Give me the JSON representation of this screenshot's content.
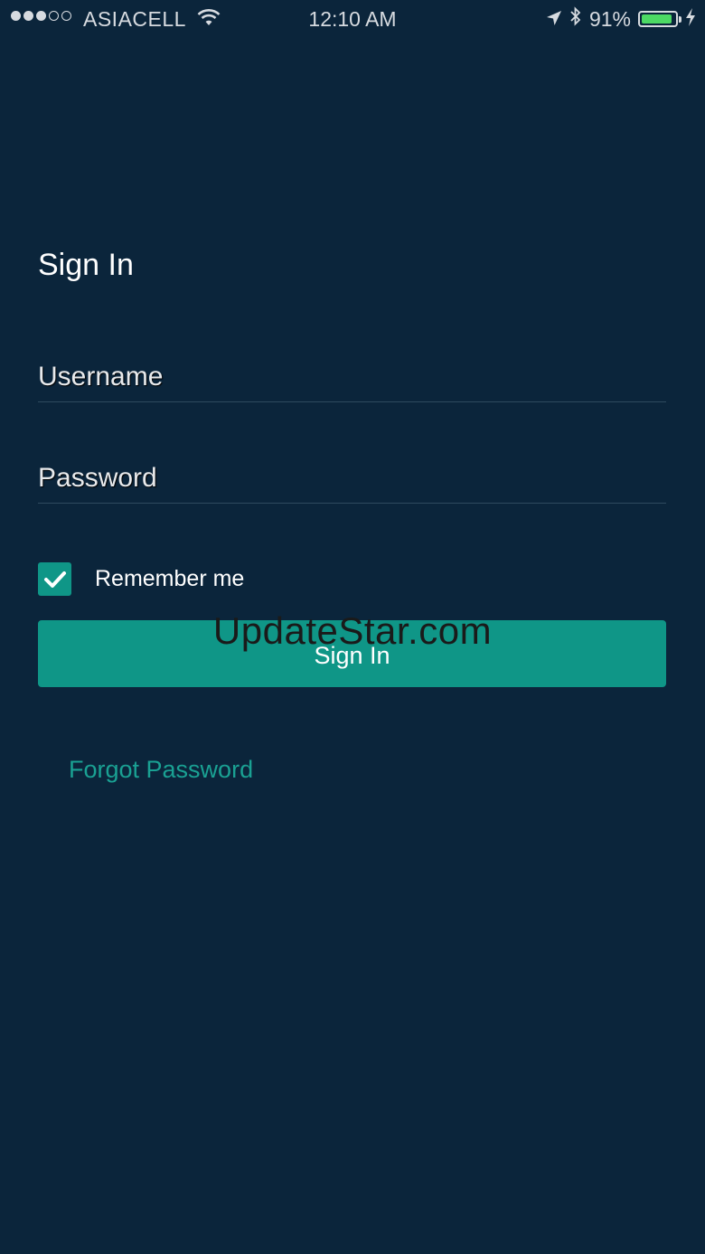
{
  "status_bar": {
    "carrier": "ASIACELL",
    "time": "12:10 AM",
    "battery_percent": "91%",
    "battery_level": 0.91,
    "signal_bars_filled": 3,
    "signal_bars_total": 5
  },
  "form": {
    "title": "Sign In",
    "username_placeholder": "Username",
    "password_placeholder": "Password",
    "remember_label": "Remember me",
    "remember_checked": true,
    "submit_label": "Sign In",
    "forgot_label": "Forgot Password"
  },
  "watermark": "UpdateStar.com",
  "colors": {
    "background": "#0b253b",
    "accent": "#0f9687",
    "link": "#1aa193",
    "battery": "#4cd964"
  }
}
